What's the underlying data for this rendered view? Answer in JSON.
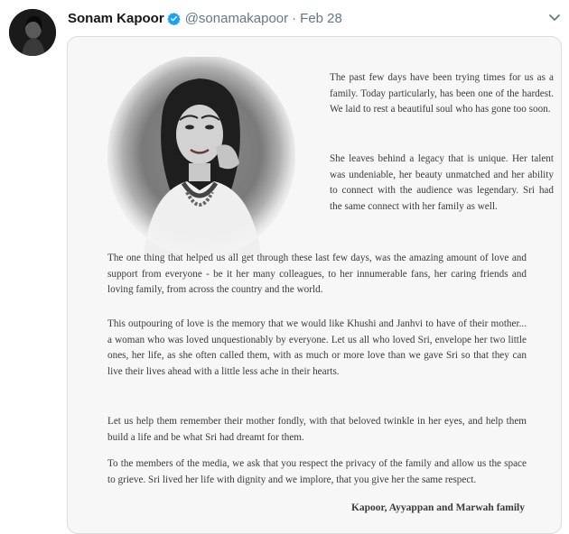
{
  "tweet": {
    "author_name": "Sonam Kapoor",
    "handle": "@sonamakapoor",
    "separator": "·",
    "date": "Feb 28",
    "verified": true,
    "icons": [
      "avatar",
      "verified-badge-icon",
      "chevron-down-icon"
    ],
    "accent_color": "#1da1f2"
  },
  "letter": {
    "paragraphs": [
      "The past few days have been trying times for us as a family. Today particularly, has been one of the hardest. We laid to rest a beautiful soul who has gone too soon.",
      "She leaves behind a legacy that is unique. Her talent was undeniable, her beauty unmatched and her ability to connect with the audience was legendary. Sri had the same connect with her family as well.",
      "The one thing that helped us all get through these last few days, was the amazing amount of love and support from everyone - be it her many colleagues, to her innumerable fans, her caring friends and loving family, from across the country and the world.",
      "This outpouring of love is the memory that we would like Khushi and Janhvi to have of their mother... a woman who was loved unquestionably by everyone. Let us all who loved Sri, envelope her two little ones, her life, as she often called them, with as much or more love than we gave Sri so that they can live their lives ahead with a little less ache in their hearts.",
      "Let us help them remember their mother fondly, with that beloved twinkle in her eyes, and help them build a life and be what Sri had dreamt for them.",
      "To the members of the media, we ask that you respect the privacy of the family and allow us the space to grieve. Sri lived her life with dignity and we implore, that you give her the same respect."
    ],
    "signature": "Kapoor, Ayyappan and Marwah family"
  }
}
